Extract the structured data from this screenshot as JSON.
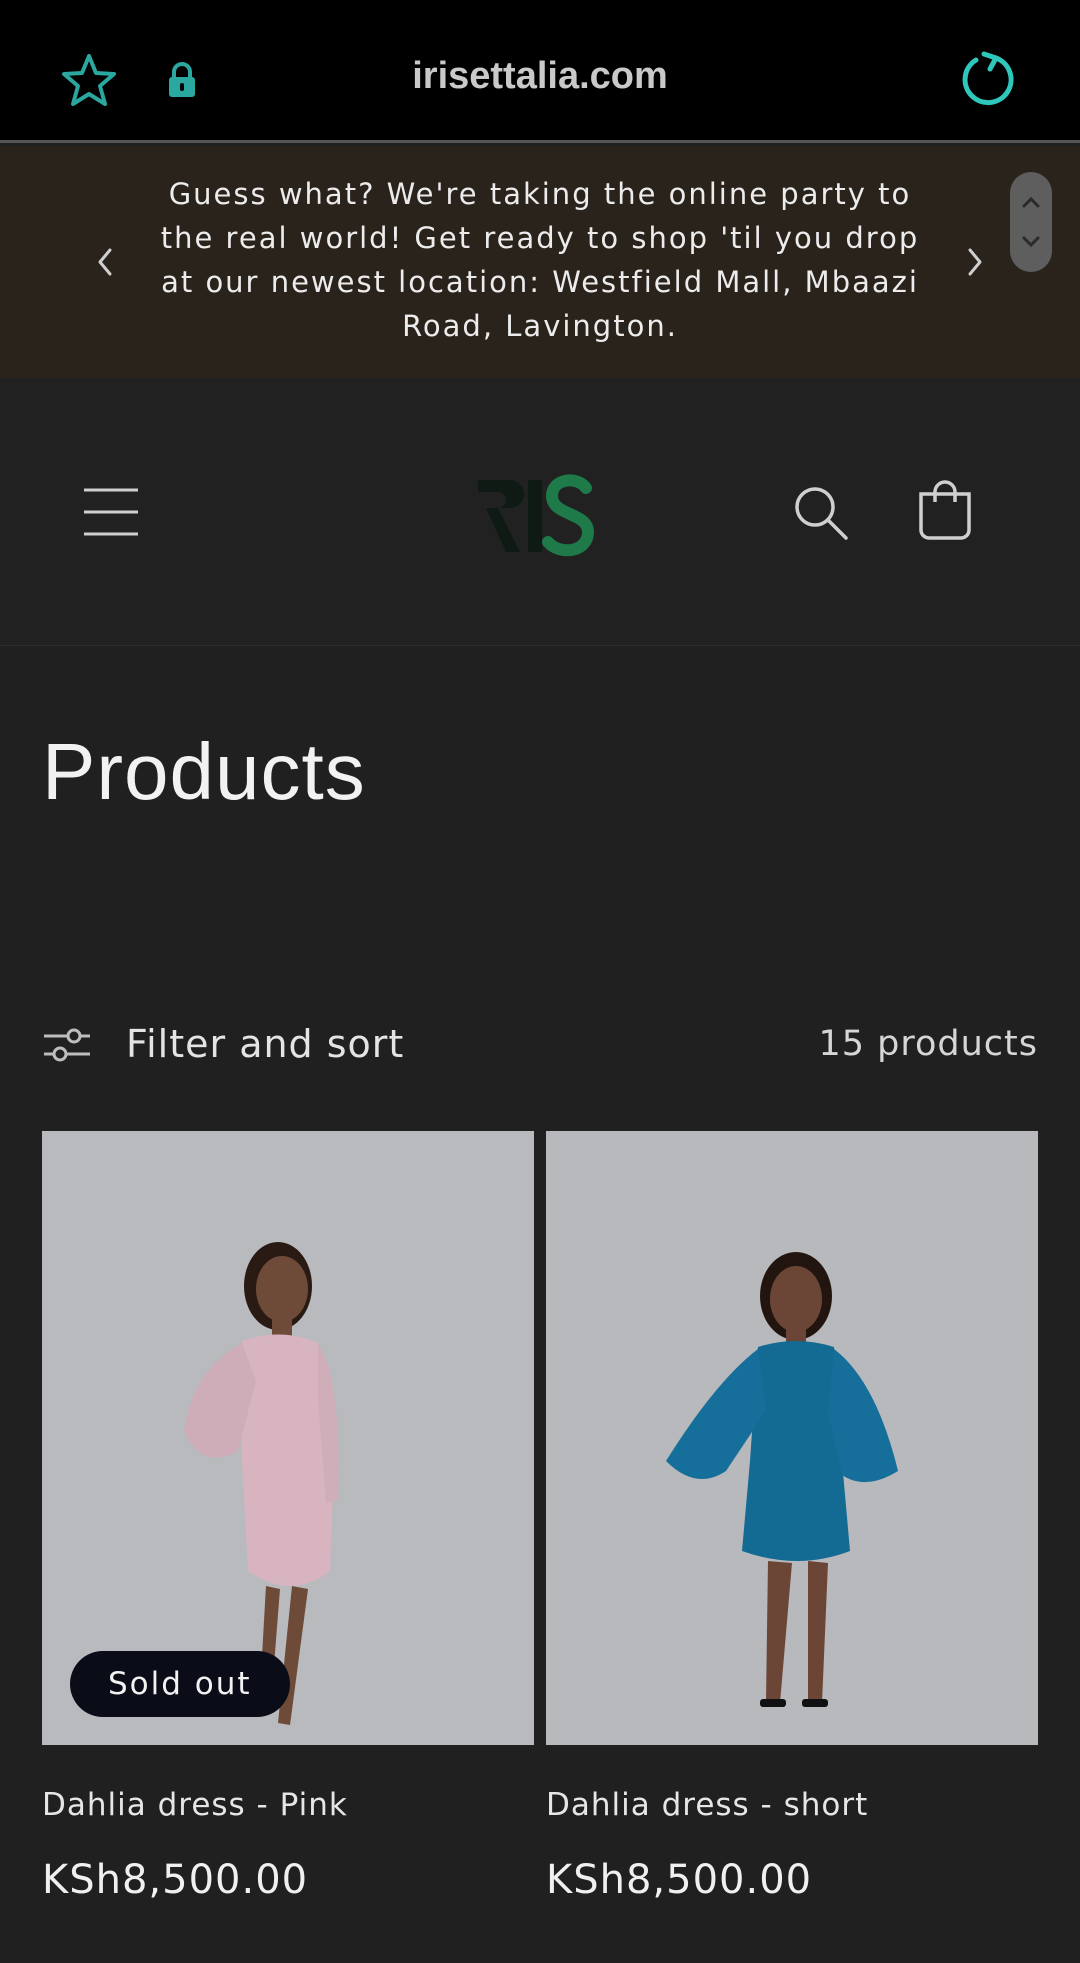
{
  "browser": {
    "url": "irisettalia.com",
    "icons": {
      "bookmark": "star-icon",
      "security": "lock-icon",
      "reload": "reload-icon"
    },
    "accent": "#2aa8a0"
  },
  "announcement": {
    "text": "Guess what? We're taking the online party to the real world! Get ready to shop 'til you drop at our newest location: Westfield Mall, Mbaazi Road, Lavington.",
    "icons": {
      "prev": "chevron-left-icon",
      "next": "chevron-right-icon"
    }
  },
  "header": {
    "icons": {
      "menu": "hamburger-menu-icon",
      "search": "search-icon",
      "cart": "cart-icon"
    },
    "logo_text": "RIS"
  },
  "main": {
    "title": "Products",
    "filter_label": "Filter and sort",
    "product_count": "15 products"
  },
  "products": [
    {
      "name": "Dahlia dress - Pink",
      "price": "KSh8,500.00",
      "badge": "Sold out",
      "color": "#e6c3ce"
    },
    {
      "name": "Dahlia dress - short",
      "price": "KSh8,500.00",
      "color": "#0e6a99"
    }
  ]
}
